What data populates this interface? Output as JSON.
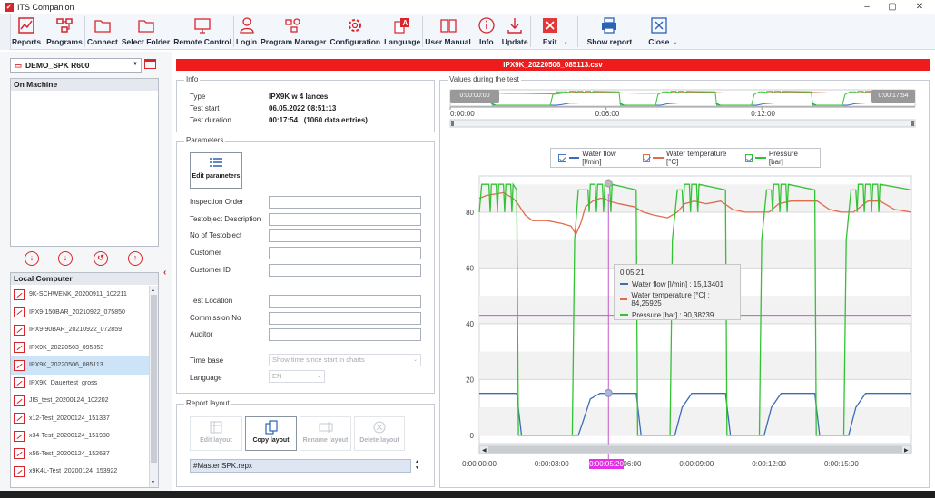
{
  "window": {
    "title": "ITS Companion",
    "controls": [
      "–",
      "▢",
      "✕"
    ]
  },
  "ribbon": {
    "buttons": [
      {
        "label": "Reports",
        "icon": "reports-icon"
      },
      {
        "label": "Programs",
        "icon": "programs-icon"
      },
      {
        "label": "Connect",
        "icon": "connect-icon"
      },
      {
        "label": "Select Folder",
        "icon": "folder-icon"
      },
      {
        "label": "Remote Control",
        "icon": "monitor-icon"
      },
      {
        "label": "Login",
        "icon": "user-icon"
      },
      {
        "label": "Program Manager",
        "icon": "program-manager-icon"
      },
      {
        "label": "Configuration",
        "icon": "gear-icon"
      },
      {
        "label": "Language",
        "icon": "language-icon"
      },
      {
        "label": "User Manual",
        "icon": "book-icon"
      },
      {
        "label": "Info",
        "icon": "info-icon"
      },
      {
        "label": "Update",
        "icon": "download-icon"
      },
      {
        "label": "Exit",
        "icon": "exit-icon"
      },
      {
        "label": "Show report",
        "icon": "printer-icon"
      },
      {
        "label": "Close",
        "icon": "close-icon"
      }
    ],
    "overflow": "⌄"
  },
  "left": {
    "device": "DEMO_SPK R600",
    "on_machine_header": "On Machine",
    "transfer_icons": [
      "↓",
      "↓",
      "↺",
      "↑"
    ],
    "local_header": "Local Computer",
    "files": [
      "9K-SCHWENK_20200911_102211",
      "IPX9-150BAR_20210922_075850",
      "IPX9-90BAR_20210922_072859",
      "IPX9K_20220503_095853",
      "IPX9K_20220506_085113",
      "IPX9K_Dauertest_gross",
      "JIS_test_20200124_102202",
      "x12-Test_20200124_151337",
      "x34-Test_20200124_151930",
      "x56-Test_20200124_152637",
      "x9K4L-Test_20200124_153922"
    ],
    "selected_index": 4,
    "collapse": "‹"
  },
  "file_title": "IPX9K_20220506_085113.csv",
  "info": {
    "group_label": "Info",
    "type_label": "Type",
    "type_value": "IPX9K w 4 lances",
    "start_label": "Test start",
    "start_value": "06.05.2022 08:51:13",
    "duration_label": "Test duration",
    "duration_value": "00:17:54   (1060 data entries)"
  },
  "parameters": {
    "group_label": "Parameters",
    "edit_button": "Edit parameters",
    "fields1": [
      "Inspection Order",
      "Testobject Description",
      "No of Testobject",
      "Customer",
      "Customer ID"
    ],
    "fields2": [
      "Test Location",
      "Commission No",
      "Auditor"
    ],
    "timebase_label": "Time base",
    "timebase_value": "Show time since start in charts",
    "language_label": "Language",
    "language_value": "EN"
  },
  "report_layout": {
    "group_label": "Report layout",
    "buttons": [
      "Edit layout",
      "Copy layout",
      "Rename layout",
      "Delete layout"
    ],
    "selected_layout": "#Master SPK.repx"
  },
  "values_group_label": "Values during the test",
  "overview": {
    "start_time": "0:00:00:00",
    "end_time": "0:00:17:54",
    "axis_ticks": [
      "0:00:00",
      "0:06:00",
      "0:12:00"
    ]
  },
  "legend": [
    {
      "name": "Water flow [l/min]",
      "color": "#3e6bb8"
    },
    {
      "name": "Water temperature [°C]",
      "color": "#e06b4f"
    },
    {
      "name": "Pressure [bar]",
      "color": "#33c233"
    }
  ],
  "tooltip": {
    "time": "0:05:21",
    "rows": [
      "Water flow [l/min] : 15,13401",
      "Water temperature [°C] : 84,25925",
      "Pressure [bar] : 90,38239"
    ]
  },
  "cursor_label": "0:00:05:20",
  "chart_data": {
    "type": "line",
    "ylim": [
      -3,
      93
    ],
    "xlim_minutes": [
      0,
      17.9
    ],
    "yticks": [
      0,
      20,
      40,
      60,
      80
    ],
    "xticks": [
      "0:00:00:00",
      "0:00:03:00",
      "0:00:06:00",
      "0:00:09:00",
      "0:00:12:00",
      "0:00:15:00"
    ],
    "cursor_minute": 5.35,
    "horizontal_marker": 43,
    "series": [
      {
        "name": "Water flow [l/min]",
        "color": "#3e6bb8",
        "x": [
          0,
          1.55,
          1.75,
          3.85,
          4.1,
          4.3,
          4.6,
          5.0,
          5.35,
          6.5,
          6.7,
          7.9,
          8.1,
          8.4,
          8.8,
          10.2,
          10.4,
          11.6,
          11.8,
          12.1,
          12.5,
          13.9,
          14.1,
          15.1,
          15.3,
          15.6,
          16.0,
          17.9
        ],
        "y": [
          15,
          15,
          0,
          0,
          0,
          5,
          13,
          15,
          15,
          15,
          0,
          0,
          0,
          10,
          15,
          15,
          0,
          0,
          0,
          10,
          15,
          15,
          0,
          0,
          0,
          10,
          15,
          15
        ]
      },
      {
        "name": "Water temperature [°C]",
        "color": "#e06b4f",
        "x": [
          0,
          0.3,
          1.0,
          1.4,
          1.6,
          1.9,
          2.2,
          2.8,
          3.4,
          3.8,
          4.0,
          4.2,
          4.4,
          4.7,
          5.0,
          5.2,
          5.35,
          5.8,
          6.4,
          6.8,
          7.2,
          7.8,
          8.2,
          8.5,
          8.9,
          9.4,
          10.0,
          10.5,
          11.0,
          11.6,
          12.0,
          12.4,
          12.9,
          13.5,
          14.0,
          14.5,
          15.0,
          15.5,
          16.1,
          16.6,
          17.2,
          17.9
        ],
        "y": [
          85,
          86,
          87,
          85,
          83,
          79,
          77,
          77,
          76,
          75,
          72,
          76,
          82,
          84,
          85,
          85,
          84,
          83,
          82,
          80,
          79,
          78,
          80,
          83,
          84,
          83,
          84,
          81,
          80,
          80,
          80,
          83,
          84,
          84,
          84,
          81,
          80,
          80,
          84,
          84,
          81,
          80
        ]
      },
      {
        "name": "Pressure [bar]",
        "color": "#33c233",
        "x": [
          0,
          0.1,
          0.4,
          0.45,
          0.5,
          0.7,
          0.75,
          0.8,
          1.0,
          1.05,
          1.1,
          1.3,
          1.35,
          1.4,
          1.55,
          1.62,
          3.85,
          3.95,
          4.1,
          4.3,
          4.5,
          4.55,
          4.6,
          4.8,
          4.85,
          4.9,
          5.1,
          5.15,
          5.2,
          5.4,
          5.45,
          5.5,
          6.5,
          6.56,
          7.9,
          8.0,
          8.2,
          8.4,
          8.45,
          8.5,
          8.7,
          8.75,
          8.8,
          9.0,
          9.05,
          9.1,
          10.2,
          10.26,
          11.6,
          11.7,
          11.9,
          12.1,
          12.15,
          12.2,
          12.4,
          12.45,
          12.5,
          12.7,
          12.75,
          12.8,
          13.9,
          13.96,
          15.1,
          15.2,
          15.4,
          15.6,
          15.65,
          15.7,
          15.9,
          15.95,
          16.0,
          16.2,
          16.25,
          16.3,
          16.5,
          16.55,
          16.6,
          17.9
        ],
        "y": [
          80,
          90,
          90,
          80,
          90,
          90,
          80,
          90,
          90,
          80,
          90,
          90,
          80,
          90,
          88,
          0,
          0,
          70,
          88,
          88,
          88,
          80,
          90,
          90,
          80,
          90,
          90,
          80,
          90,
          90,
          80,
          90,
          88,
          0,
          0,
          70,
          88,
          88,
          80,
          90,
          90,
          80,
          90,
          90,
          80,
          90,
          88,
          0,
          0,
          70,
          88,
          88,
          80,
          90,
          90,
          80,
          90,
          90,
          80,
          90,
          88,
          0,
          0,
          70,
          88,
          88,
          80,
          90,
          90,
          80,
          90,
          90,
          80,
          90,
          90,
          80,
          90,
          88
        ]
      }
    ]
  }
}
